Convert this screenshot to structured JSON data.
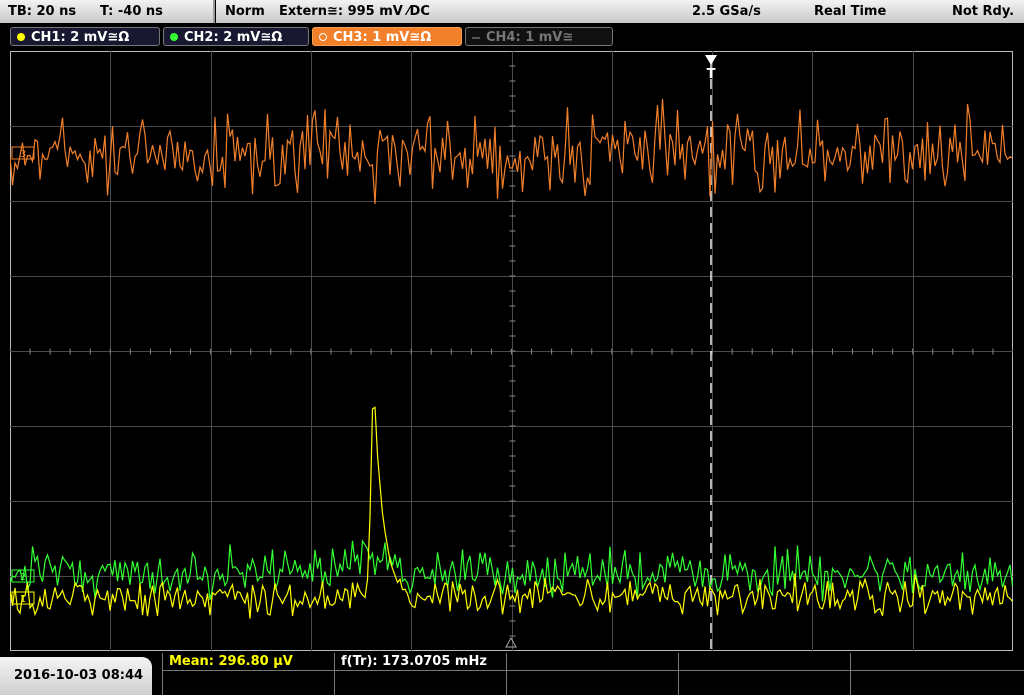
{
  "topbar": {
    "timebase": "TB: 20 ns",
    "trigger_time": "T: -40 ns",
    "mode": "Norm",
    "trigger_source": "Extern≅: 995 mV ⁄DC",
    "sample_rate": "2.5 GSa/s",
    "acq_mode": "Real Time",
    "status": "Not Rdy."
  },
  "channels": [
    {
      "label": "CH1: 2 mV≅Ω",
      "color": "#ffff00",
      "active": true
    },
    {
      "label": "CH2: 2 mV≅Ω",
      "color": "#33ff33",
      "active": true
    },
    {
      "label": "CH3: 1 mV≅Ω",
      "color": "#f2802a",
      "active": true
    },
    {
      "label": "CH4: 1 mV≅",
      "color": "#555555",
      "active": false
    }
  ],
  "markers": {
    "trigger": "T",
    "ch3_marker": "3",
    "ch2_marker": "2",
    "ch1_marker": "1"
  },
  "bottom": {
    "datetime": "2016-10-03 08:44",
    "mean": "Mean: 296.80 µV",
    "frequency": "f(Tr): 173.0705 mHz"
  },
  "colors": {
    "ch1": "#ffff00",
    "ch2": "#33ff33",
    "ch3": "#f2802a",
    "grid": "#555555"
  }
}
